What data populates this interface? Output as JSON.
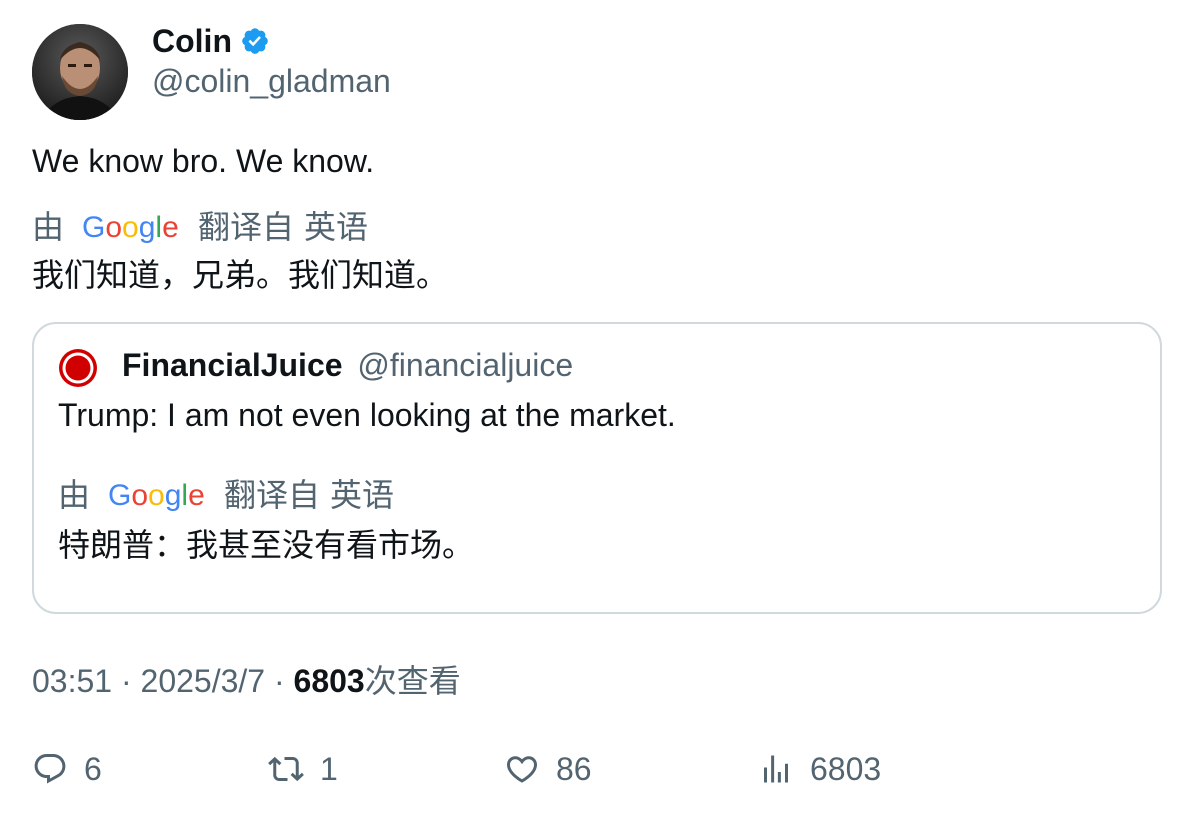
{
  "author": {
    "display_name": "Colin",
    "handle": "@colin_gladman",
    "verified_icon": "verified-badge-icon",
    "avatar": "avatar-photo"
  },
  "tweet": {
    "text": "We know bro. We know.",
    "translation": {
      "by_label": "由",
      "provider": "Google",
      "translated_from": "翻译自",
      "language": "英语",
      "text": "我们知道，兄弟。我们知道。"
    }
  },
  "quote": {
    "name": "FinancialJuice",
    "handle": "@financialjuice",
    "text": "Trump: I am not even looking at the market.",
    "translation": {
      "by_label": "由",
      "provider": "Google",
      "translated_from": "翻译自",
      "language": "英语",
      "text": "特朗普：我甚至没有看市场。"
    }
  },
  "meta": {
    "time": "03:51",
    "separator": "·",
    "date": "2025/3/7",
    "views_count": "6803",
    "views_label": "次查看"
  },
  "actions": {
    "replies": "6",
    "retweets": "1",
    "likes": "86",
    "views": "6803"
  },
  "colors": {
    "text_primary": "#0f1419",
    "text_secondary": "#536471",
    "verified_blue": "#1d9bf0",
    "border": "#cfd9de",
    "google_blue": "#4285f4",
    "google_red": "#ea4335",
    "google_yellow": "#fbbc05",
    "google_green": "#34a853"
  }
}
